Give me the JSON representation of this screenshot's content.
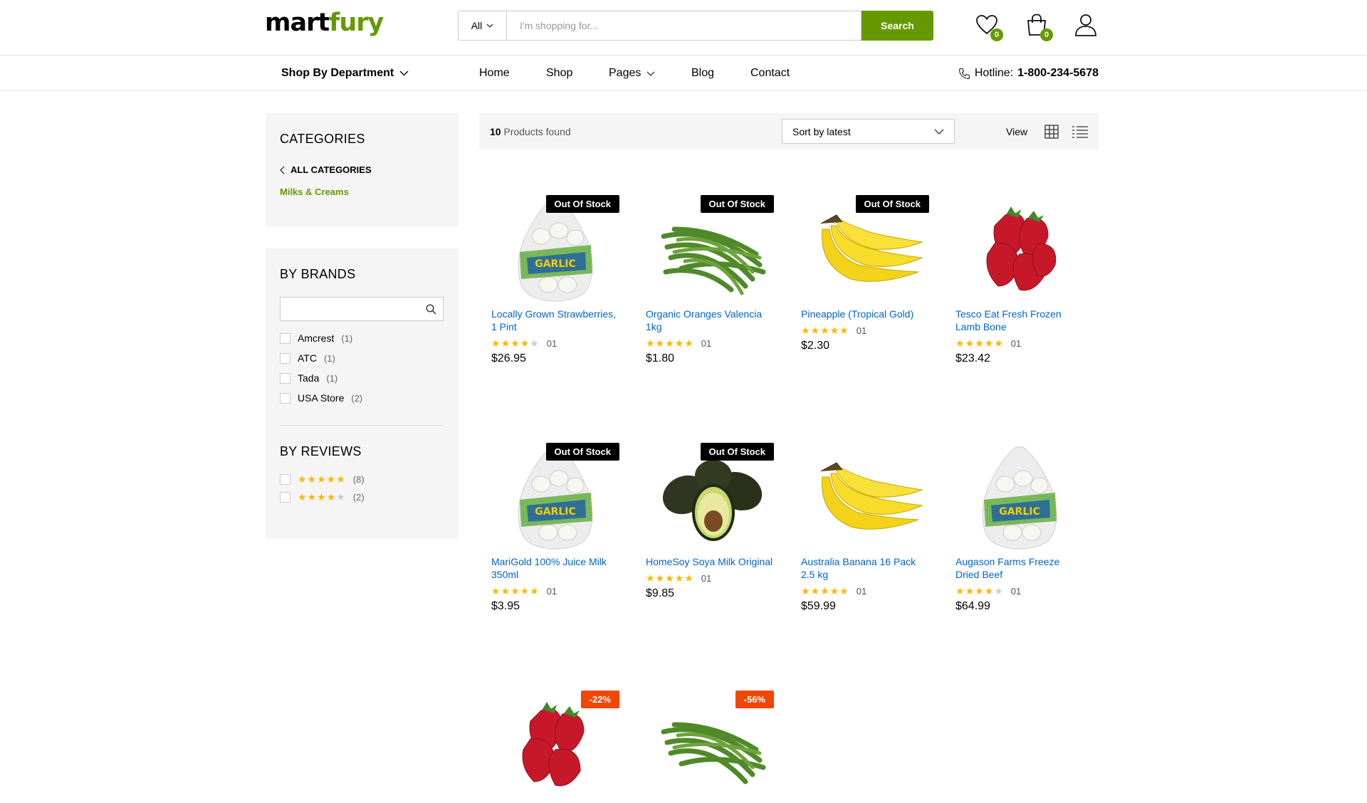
{
  "header": {
    "logo_part1": "mart",
    "logo_part2": "fury",
    "search_category": "All",
    "search_placeholder": "I'm shopping for...",
    "search_button": "Search",
    "wishlist_count": "0",
    "cart_count": "0"
  },
  "nav": {
    "department": "Shop By Department",
    "links": [
      "Home",
      "Shop",
      "Pages",
      "Blog",
      "Contact"
    ],
    "hotline_label": "Hotline:",
    "hotline_number": "1-800-234-5678"
  },
  "sidebar": {
    "categories_title": "CATEGORIES",
    "all_categories": "ALL CATEGORIES",
    "active_category": "Milks & Creams",
    "brands_title": "BY BRANDS",
    "brands": [
      {
        "name": "Amcrest",
        "count": "(1)"
      },
      {
        "name": "ATC",
        "count": "(1)"
      },
      {
        "name": "Tada",
        "count": "(1)"
      },
      {
        "name": "USA Store",
        "count": "(2)"
      }
    ],
    "reviews_title": "BY REVIEWS",
    "reviews": [
      {
        "stars": 5,
        "count": "(8)"
      },
      {
        "stars": 4,
        "count": "(2)"
      }
    ]
  },
  "toolbar": {
    "count": "10",
    "found_label": "Products found",
    "sort_value": "Sort by latest",
    "view_label": "View"
  },
  "products": [
    {
      "name": "Locally Grown Strawberries, 1 Pint",
      "rating": 4,
      "reviews": "01",
      "price": "$26.95",
      "badge": "Out Of Stock",
      "image": "garlic-bag"
    },
    {
      "name": "Organic Oranges Valencia 1kg",
      "rating": 5,
      "reviews": "01",
      "price": "$1.80",
      "badge": "Out Of Stock",
      "image": "green-beans"
    },
    {
      "name": "Pineapple (Tropical Gold)",
      "rating": 5,
      "reviews": "01",
      "price": "$2.30",
      "badge": "Out Of Stock",
      "image": "bananas"
    },
    {
      "name": "Tesco Eat Fresh Frozen Lamb Bone",
      "rating": 5,
      "reviews": "01",
      "price": "$23.42",
      "badge": "",
      "image": "strawberries"
    },
    {
      "name": "MariGold 100% Juice Milk 350ml",
      "rating": 5,
      "reviews": "01",
      "price": "$3.95",
      "badge": "Out Of Stock",
      "image": "garlic-bag"
    },
    {
      "name": "HomeSoy Soya Milk Original",
      "rating": 5,
      "reviews": "01",
      "price": "$9.85",
      "badge": "Out Of Stock",
      "image": "avocados"
    },
    {
      "name": "Australia Banana 16 Pack 2.5 kg",
      "rating": 5,
      "reviews": "01",
      "price": "$59.99",
      "badge": "",
      "image": "bananas"
    },
    {
      "name": "Augason Farms Freeze Dried Beef",
      "rating": 4,
      "reviews": "01",
      "price": "$64.99",
      "badge": "",
      "image": "garlic-bag"
    },
    {
      "name": "",
      "rating": 0,
      "reviews": "",
      "price": "",
      "badge": "-22%",
      "image": "strawberries"
    },
    {
      "name": "",
      "rating": 0,
      "reviews": "",
      "price": "",
      "badge": "-56%",
      "image": "green-beans"
    }
  ],
  "colors": {
    "brand": "#669900",
    "star": "#fcb800",
    "sale": "#f14705",
    "link": "#0066cc"
  }
}
